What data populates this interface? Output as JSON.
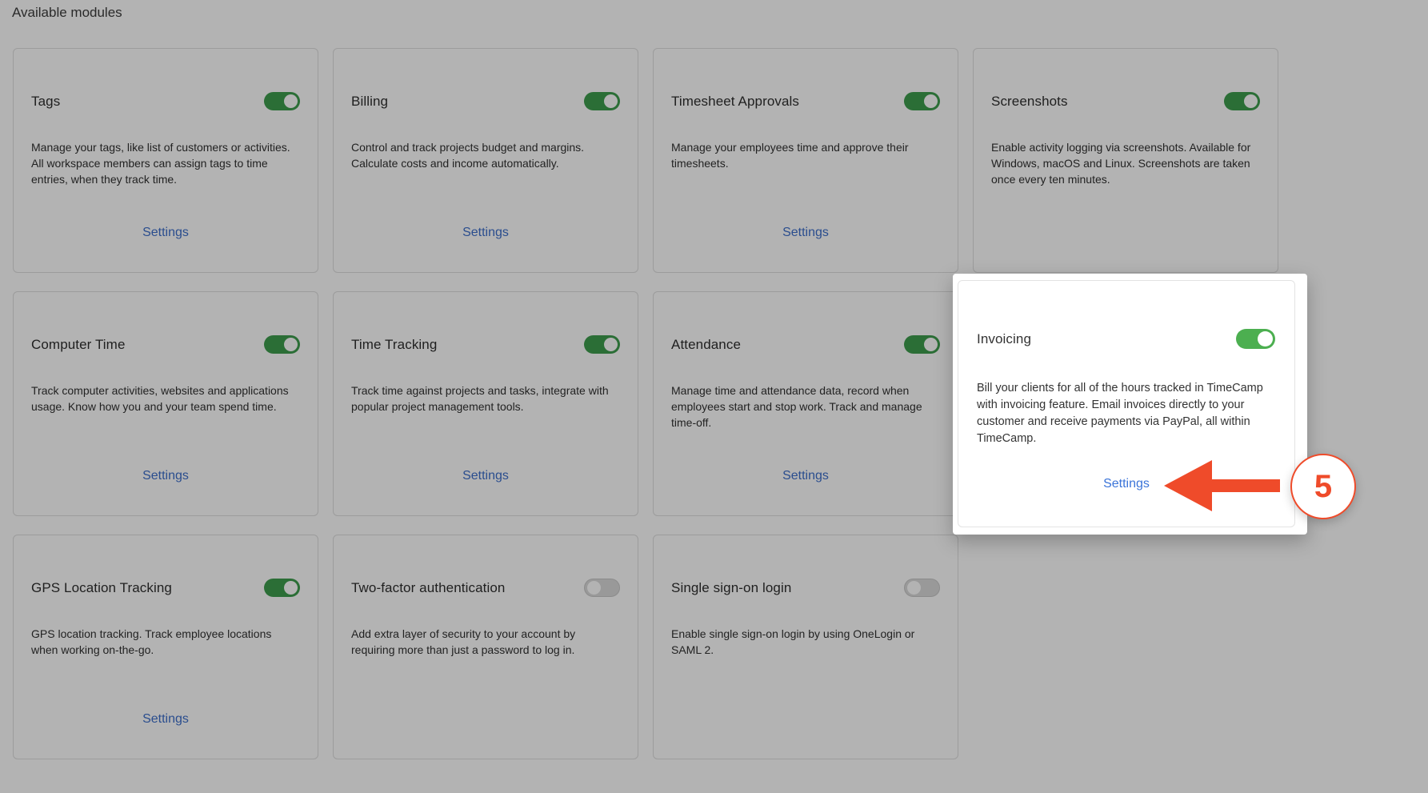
{
  "section_title": "Available modules",
  "modules": [
    {
      "title": "Tags",
      "enabled": true,
      "description": "Manage your tags, like list of customers or activities. All workspace members can assign tags to time entries, when they track time.",
      "settings_label": "Settings"
    },
    {
      "title": "Billing",
      "enabled": true,
      "description": "Control and track projects budget and margins. Calculate costs and income automatically.",
      "settings_label": "Settings"
    },
    {
      "title": "Timesheet Approvals",
      "enabled": true,
      "description": "Manage your employees time and approve their timesheets.",
      "settings_label": "Settings"
    },
    {
      "title": "Screenshots",
      "enabled": true,
      "description": "Enable activity logging via screenshots. Available for Windows, macOS and Linux. Screenshots are taken once every ten minutes.",
      "settings_label": ""
    },
    {
      "title": "Computer Time",
      "enabled": true,
      "description": "Track computer activities, websites and applications usage. Know how you and your team spend time.",
      "settings_label": "Settings"
    },
    {
      "title": "Time Tracking",
      "enabled": true,
      "description": "Track time against projects and tasks, integrate with popular project management tools.",
      "settings_label": "Settings"
    },
    {
      "title": "Attendance",
      "enabled": true,
      "description": "Manage time and attendance data, record when employees start and stop work. Track and manage time-off.",
      "settings_label": "Settings"
    },
    {
      "title": "GPS Location Tracking",
      "enabled": true,
      "description": "GPS location tracking. Track employee locations when working on-the-go.",
      "settings_label": "Settings"
    },
    {
      "title": "Two-factor authentication",
      "enabled": false,
      "description": "Add extra layer of security to your account by requiring more than just a password to log in.",
      "settings_label": ""
    },
    {
      "title": "Single sign-on login",
      "enabled": false,
      "description": "Enable single sign-on login by using OneLogin or SAML 2.",
      "settings_label": ""
    }
  ],
  "highlighted_module": {
    "title": "Invoicing",
    "enabled": true,
    "description": "Bill your clients for all of the hours tracked in TimeCamp with invoicing feature. Email invoices directly to your customer and receive payments via PayPal, all within TimeCamp.",
    "settings_label": "Settings"
  },
  "annotation": {
    "step_number": "5",
    "color": "#ef4b2a"
  },
  "colors": {
    "background_overlay": "#b3b3b3",
    "toggle_on_dimmed": "#2b6e36",
    "toggle_on": "#4caf50",
    "link": "#3b74d9"
  }
}
